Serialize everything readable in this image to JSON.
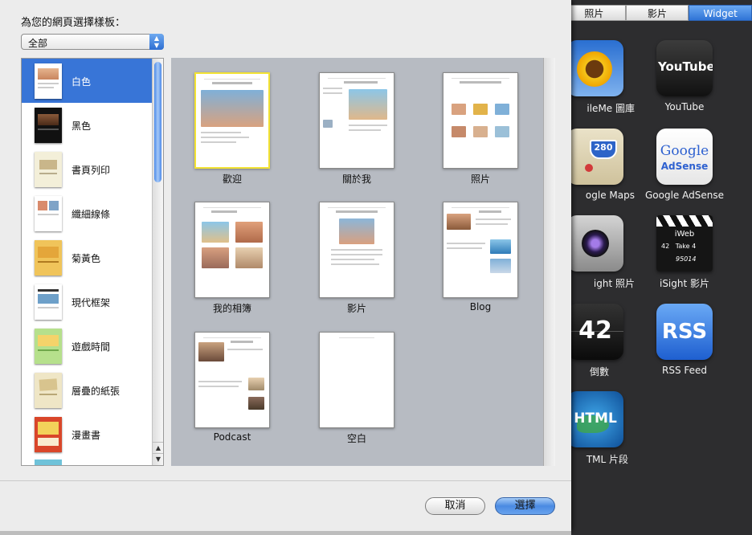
{
  "dialog": {
    "prompt": "為您的網頁選擇樣板：",
    "category": "全部",
    "themes": [
      {
        "label": "白色",
        "selected": true
      },
      {
        "label": "黑色"
      },
      {
        "label": "書頁列印"
      },
      {
        "label": "纖細線條"
      },
      {
        "label": "菊黃色"
      },
      {
        "label": "現代框架"
      },
      {
        "label": "遊戲時間"
      },
      {
        "label": "層疊的紙張"
      },
      {
        "label": "漫畫書"
      }
    ],
    "templates": [
      {
        "label": "歡迎",
        "selected": true
      },
      {
        "label": "關於我"
      },
      {
        "label": "照片"
      },
      {
        "label": "我的相簿"
      },
      {
        "label": "影片"
      },
      {
        "label": "Blog"
      },
      {
        "label": "Podcast"
      },
      {
        "label": "空白"
      }
    ],
    "cancel_label": "取消",
    "choose_label": "選擇"
  },
  "background": {
    "tabs": [
      "照片",
      "影片",
      "Widget"
    ],
    "active_tab": "Widget",
    "widgets": [
      {
        "label": "ileMe 圖庫",
        "icon": "sunflower-icon"
      },
      {
        "label": "YouTube",
        "icon": "youtube-icon"
      },
      {
        "label": "ogle Maps",
        "icon": "maps-icon"
      },
      {
        "label": "Google AdSense",
        "icon": "adsense-icon"
      },
      {
        "label": "ight 照片",
        "icon": "camera-icon"
      },
      {
        "label": "iSight 影片",
        "icon": "clapperboard-icon"
      },
      {
        "label": "倒數",
        "icon": "countdown-icon"
      },
      {
        "label": "RSS Feed",
        "icon": "rss-icon"
      },
      {
        "label": "TML 片段",
        "icon": "html-globe-icon"
      }
    ],
    "tile_texts": {
      "youtube": "YouTube",
      "google": "Google",
      "adsense": "AdSense",
      "shield": "280",
      "iweb": "iWeb",
      "clapper_row1": "42   Take 4",
      "clapper_row2": "95014",
      "countdown": "42",
      "rss": "RSS",
      "html": "HTML"
    }
  }
}
